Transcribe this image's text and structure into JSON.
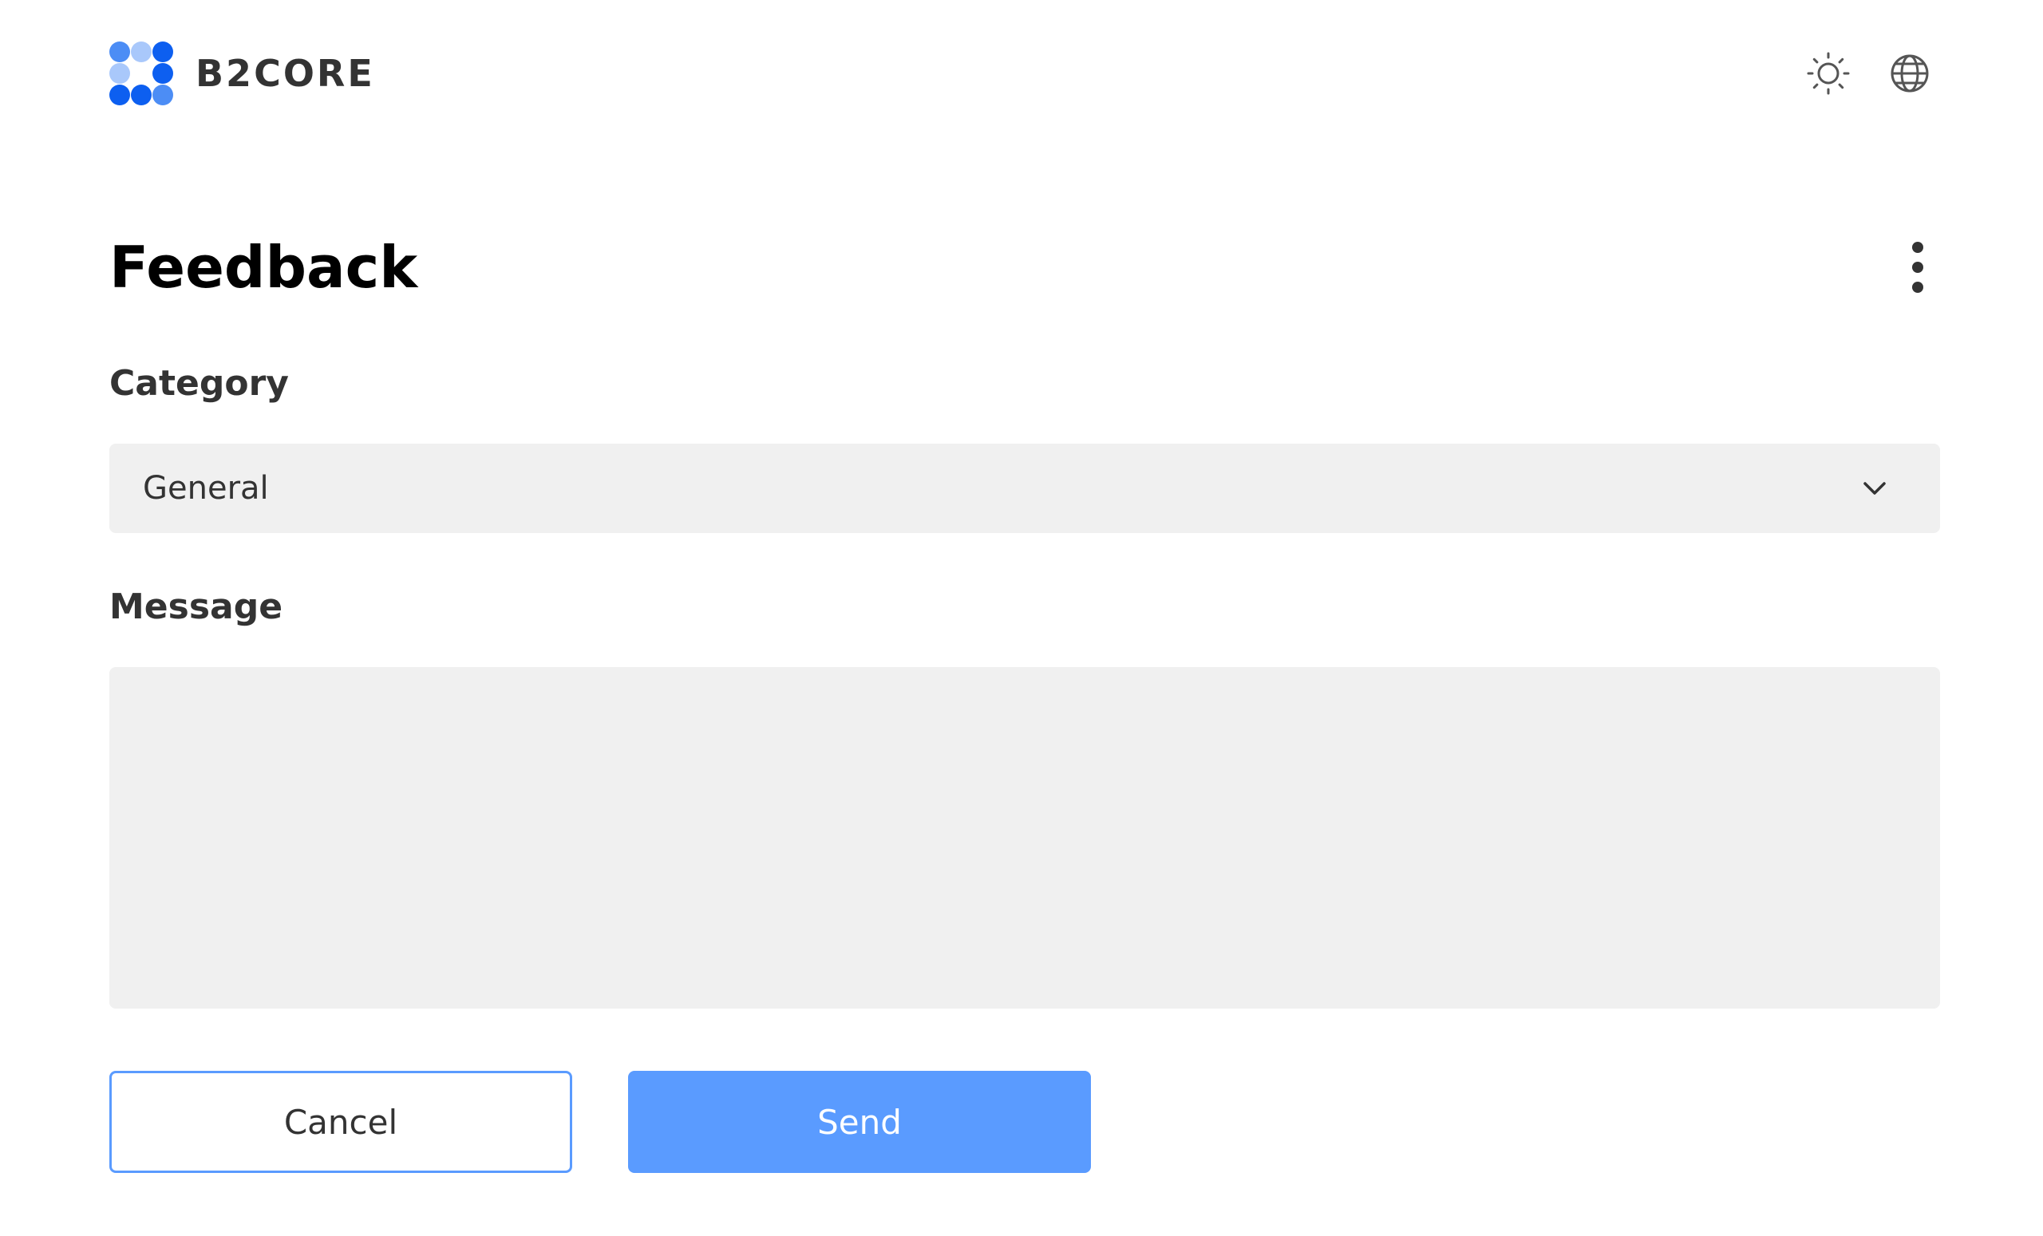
{
  "header": {
    "brand_name": "B2CORE",
    "icons": {
      "theme": "sun-icon",
      "language": "globe-icon"
    }
  },
  "page": {
    "title": "Feedback",
    "menu_icon": "more-vertical-icon"
  },
  "form": {
    "category_label": "Category",
    "category_value": "General",
    "message_label": "Message",
    "message_value": "",
    "cancel_label": "Cancel",
    "send_label": "Send"
  },
  "colors": {
    "accent": "#5a9bff",
    "logo_dark": "#0d5ff0",
    "logo_mid": "#4c8df5",
    "logo_light": "#a9c8fb",
    "field_bg": "#f0f0f0"
  }
}
